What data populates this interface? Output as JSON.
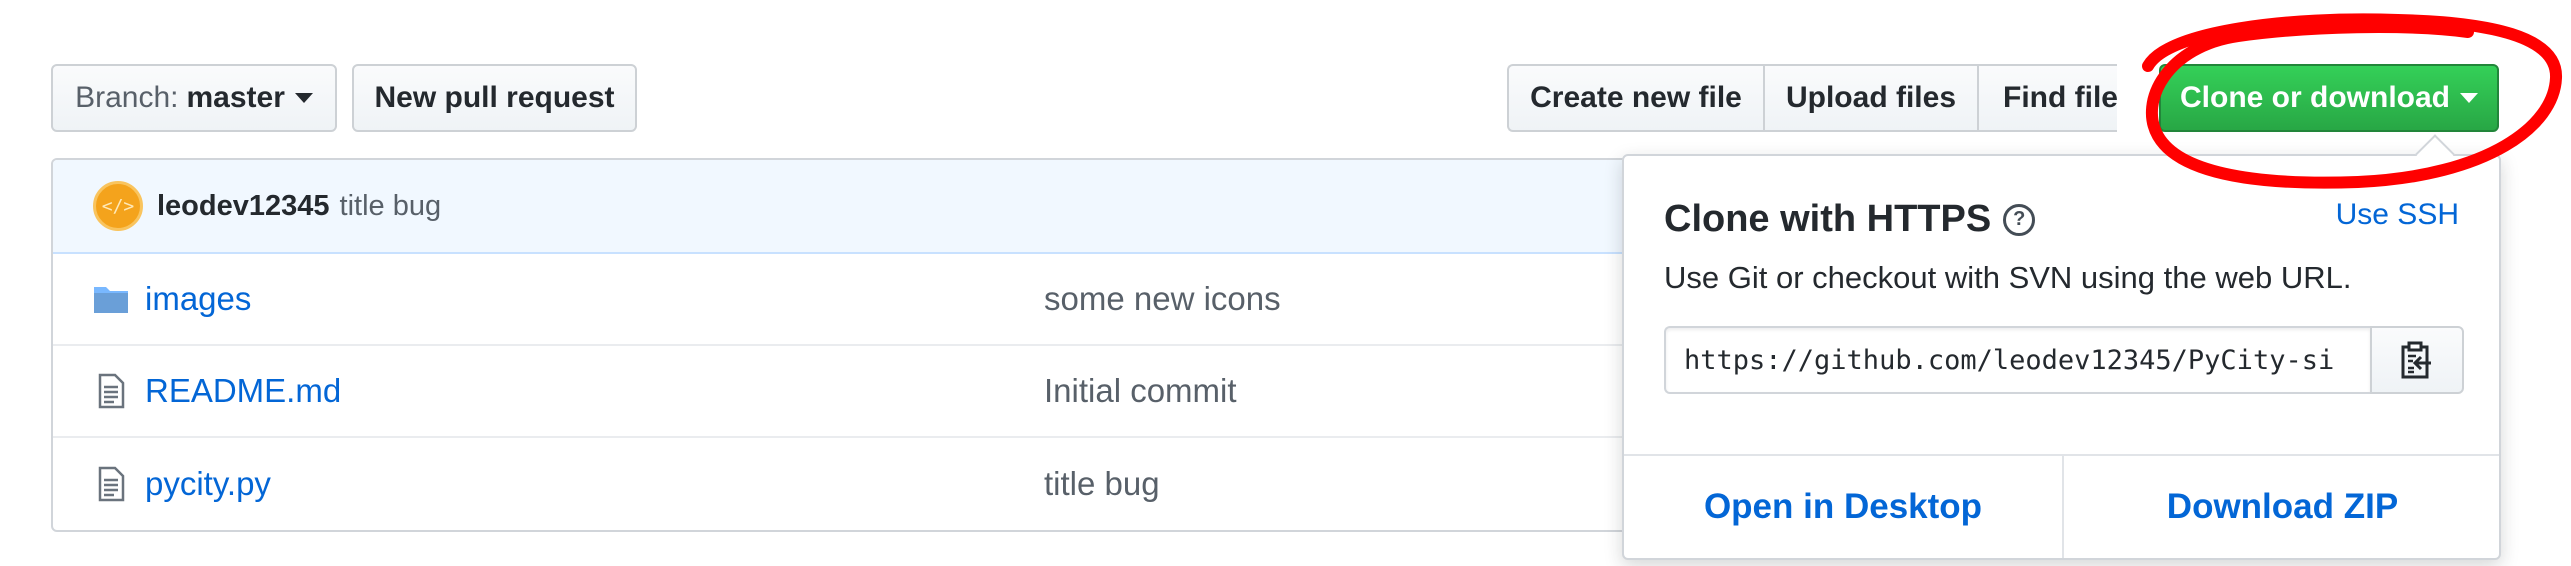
{
  "toolbar": {
    "branch_prefix": "Branch:",
    "branch_name": "master",
    "new_pull_request": "New pull request",
    "create_new_file": "Create new file",
    "upload_files": "Upload files",
    "find_file": "Find file",
    "clone_or_download": "Clone or download"
  },
  "commit": {
    "author": "leodev12345",
    "message": "title bug"
  },
  "files": [
    {
      "name": "images",
      "type": "folder",
      "message": "some new icons"
    },
    {
      "name": "README.md",
      "type": "file",
      "message": "Initial commit"
    },
    {
      "name": "pycity.py",
      "type": "file",
      "message": "title bug"
    }
  ],
  "clone_popover": {
    "title": "Clone with HTTPS",
    "use_ssh": "Use SSH",
    "description": "Use Git or checkout with SVN using the web URL.",
    "url": "https://github.com/leodev12345/PyCity-si",
    "open_desktop": "Open in Desktop",
    "download_zip": "Download ZIP"
  },
  "colors": {
    "green": "#28a745",
    "link_blue": "#0366d6",
    "annotation_red": "#ff0000"
  }
}
